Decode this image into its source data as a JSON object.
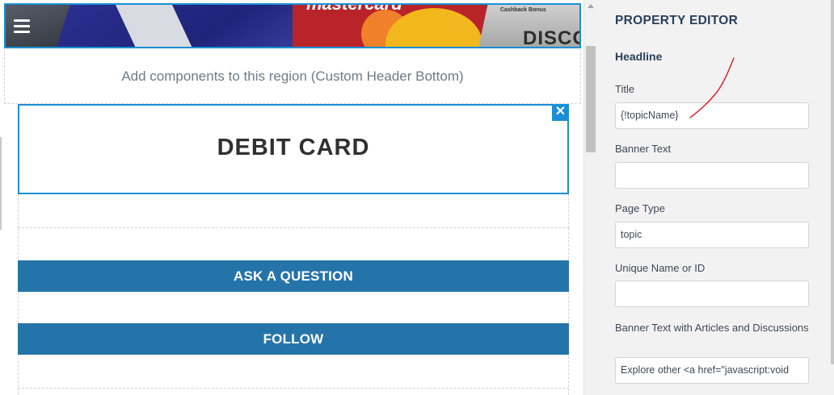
{
  "canvas": {
    "hero": {
      "mastercard_text": "mastercard",
      "cashback_text": "Cashback Bonus",
      "discover_text": "DISCOV"
    },
    "region_note": "Add components to this region (Custom Header Bottom)",
    "headline": "DEBIT CARD",
    "close_glyph": "✕",
    "buttons": {
      "ask": "ASK A QUESTION",
      "follow": "FOLLOW"
    }
  },
  "property_editor": {
    "title": "PROPERTY EDITOR",
    "section": "Headline",
    "fields": [
      {
        "label": "Title",
        "value": "{!topicName}"
      },
      {
        "label": "Banner Text",
        "value": ""
      },
      {
        "label": "Page Type",
        "value": "topic"
      },
      {
        "label": "Unique Name or ID",
        "value": ""
      },
      {
        "label": "Banner Text with Articles and Discussions",
        "value": "Explore other <a href=\"javascript:void"
      }
    ]
  },
  "colors": {
    "selection_blue": "#1b8fd6",
    "button_blue": "#2574a9",
    "panel_bg": "#f3f2f2",
    "annotation_red": "#e0141e"
  },
  "icons": [
    "hamburger-menu-icon",
    "close-icon"
  ]
}
